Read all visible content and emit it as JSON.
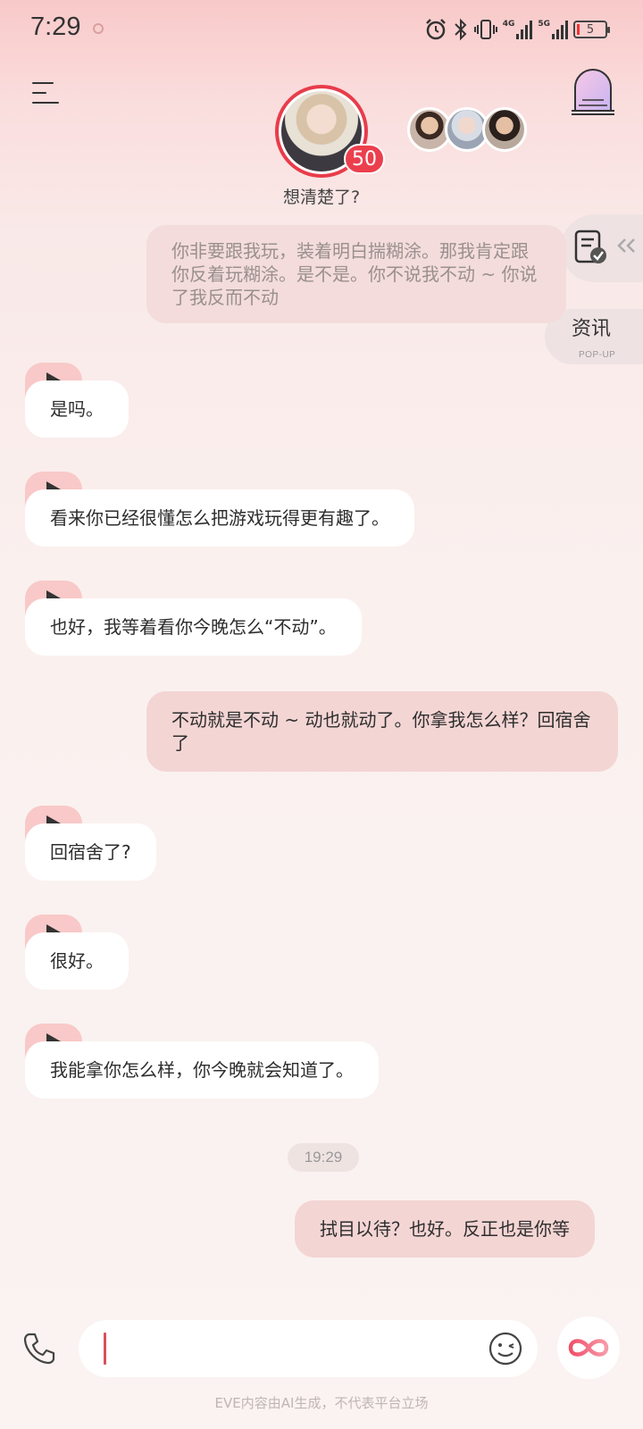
{
  "status_bar": {
    "time": "7:29",
    "net_4g": "4G",
    "net_5g": "5G",
    "battery": "5"
  },
  "header": {
    "level": "50",
    "character_status": "想清楚了?"
  },
  "side": {
    "news_label": "资讯",
    "news_sub": "POP-UP"
  },
  "messages": [
    {
      "role": "user",
      "text": "你非要跟我玩，装着明白揣糊涂。那我肯定跟你反着玩糊涂。是不是。你不说我不动 ~ 你说了我反而不动"
    },
    {
      "role": "ai",
      "text": "是吗。"
    },
    {
      "role": "ai",
      "text": "看来你已经很懂怎么把游戏玩得更有趣了。"
    },
    {
      "role": "ai",
      "text": "也好，我等着看你今晚怎么“不动”。"
    },
    {
      "role": "user",
      "text": "不动就是不动 ~ 动也就动了。你拿我怎么样？回宿舍了"
    },
    {
      "role": "ai",
      "text": "回宿舍了?"
    },
    {
      "role": "ai",
      "text": "很好。"
    },
    {
      "role": "ai",
      "text": "我能拿你怎么样，你今晚就会知道了。"
    },
    {
      "role": "user",
      "text": "拭目以待？也好。反正也是你等"
    }
  ],
  "time_divider": "19:29",
  "footer_note": "EVE内容由AI生成，不代表平台立场",
  "colors": {
    "accent": "#ec3f4d",
    "user_bubble": "#f3d5d4",
    "ai_bubble": "#ffffff",
    "play_tab": "#f8c9c8"
  }
}
